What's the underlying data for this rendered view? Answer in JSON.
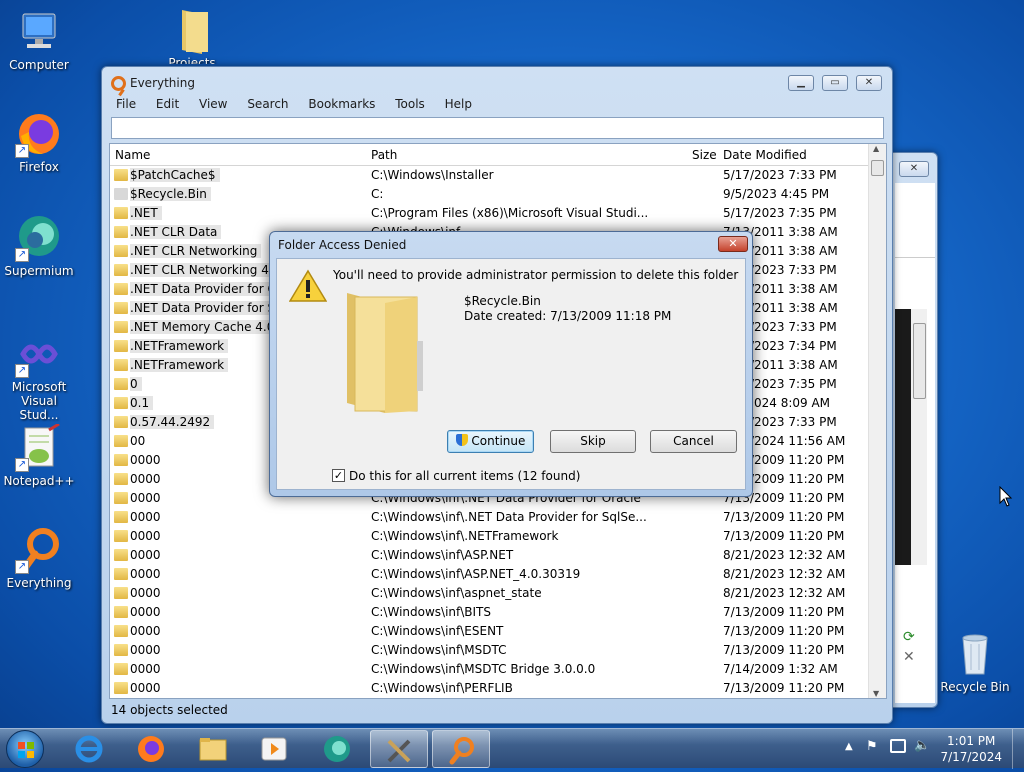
{
  "desktop": {
    "icons": [
      {
        "label": "Computer"
      },
      {
        "label": "Firefox"
      },
      {
        "label": "Supermium"
      },
      {
        "label": "Microsoft Visual Stud..."
      },
      {
        "label": "Notepad++"
      },
      {
        "label": "Everything"
      },
      {
        "label": "Projects"
      },
      {
        "label": "Recycle Bin"
      }
    ]
  },
  "window": {
    "title": "Everything",
    "menu": [
      "File",
      "Edit",
      "View",
      "Search",
      "Bookmarks",
      "Tools",
      "Help"
    ],
    "search_value": "",
    "columns": {
      "name": "Name",
      "path": "Path",
      "size": "Size",
      "date": "Date Modified"
    },
    "rows": [
      {
        "name": "$PatchCache$",
        "path": "C:\\Windows\\Installer",
        "date": "5/17/2023 7:33 PM"
      },
      {
        "name": "$Recycle.Bin",
        "path": "C:",
        "date": "9/5/2023 4:45 PM"
      },
      {
        "name": ".NET",
        "path": "C:\\Program Files (x86)\\Microsoft Visual Studi...",
        "date": "5/17/2023 7:35 PM"
      },
      {
        "name": ".NET CLR Data",
        "path": "C:\\Windows\\inf",
        "date": "7/13/2011 3:38 AM"
      },
      {
        "name": ".NET CLR Networking",
        "path": "",
        "date": "7/13/2011 3:38 AM"
      },
      {
        "name": ".NET CLR Networking 4.0.0",
        "path": "",
        "date": "5/17/2023 7:33 PM"
      },
      {
        "name": ".NET Data Provider for Ora",
        "path": "",
        "date": "7/13/2011 3:38 AM"
      },
      {
        "name": ".NET Data Provider for SqlS",
        "path": "",
        "date": "7/13/2011 3:38 AM"
      },
      {
        "name": ".NET Memory Cache 4.0",
        "path": "",
        "date": "5/17/2023 7:33 PM"
      },
      {
        "name": ".NETFramework",
        "path": "",
        "date": "5/17/2023 7:34 PM"
      },
      {
        "name": ".NETFramework",
        "path": "",
        "date": "7/13/2011 3:38 AM"
      },
      {
        "name": "0",
        "path": "",
        "date": "5/17/2023 7:35 PM"
      },
      {
        "name": "0.1",
        "path": "",
        "date": "9/5/2024 8:09 AM"
      },
      {
        "name": "0.57.44.2492",
        "path": "",
        "date": "5/17/2023 7:33 PM"
      },
      {
        "name": "00",
        "path": "",
        "date": "8/21/2024 11:56 AM"
      },
      {
        "name": "0000",
        "path": "",
        "date": "7/13/2009 11:20 PM"
      },
      {
        "name": "0000",
        "path": "",
        "date": "7/13/2009 11:20 PM"
      },
      {
        "name": "0000",
        "path": "C:\\Windows\\inf\\.NET Data Provider for Oracle",
        "date": "7/13/2009 11:20 PM"
      },
      {
        "name": "0000",
        "path": "C:\\Windows\\inf\\.NET Data Provider for SqlSe...",
        "date": "7/13/2009 11:20 PM"
      },
      {
        "name": "0000",
        "path": "C:\\Windows\\inf\\.NETFramework",
        "date": "7/13/2009 11:20 PM"
      },
      {
        "name": "0000",
        "path": "C:\\Windows\\inf\\ASP.NET",
        "date": "8/21/2023 12:32 AM"
      },
      {
        "name": "0000",
        "path": "C:\\Windows\\inf\\ASP.NET_4.0.30319",
        "date": "8/21/2023 12:32 AM"
      },
      {
        "name": "0000",
        "path": "C:\\Windows\\inf\\aspnet_state",
        "date": "8/21/2023 12:32 AM"
      },
      {
        "name": "0000",
        "path": "C:\\Windows\\inf\\BITS",
        "date": "7/13/2009 11:20 PM"
      },
      {
        "name": "0000",
        "path": "C:\\Windows\\inf\\ESENT",
        "date": "7/13/2009 11:20 PM"
      },
      {
        "name": "0000",
        "path": "C:\\Windows\\inf\\MSDTC",
        "date": "7/13/2009 11:20 PM"
      },
      {
        "name": "0000",
        "path": "C:\\Windows\\inf\\MSDTC Bridge 3.0.0.0",
        "date": "7/14/2009 1:32 AM"
      },
      {
        "name": "0000",
        "path": "C:\\Windows\\inf\\PERFLIB",
        "date": "7/13/2009 11:20 PM"
      }
    ],
    "status": "14 objects selected"
  },
  "dialog": {
    "title": "Folder Access Denied",
    "close": "✕",
    "message": "You'll need to provide administrator permission to delete this folder",
    "item_name": "$Recycle.Bin",
    "item_date": "Date created: 7/13/2009 11:18 PM",
    "continue_label": "Continue",
    "skip_label": "Skip",
    "cancel_label": "Cancel",
    "checkbox_label": "Do this for all current items (12 found)"
  },
  "taskbar": {
    "time": "1:01 PM",
    "date": "7/17/2024"
  }
}
